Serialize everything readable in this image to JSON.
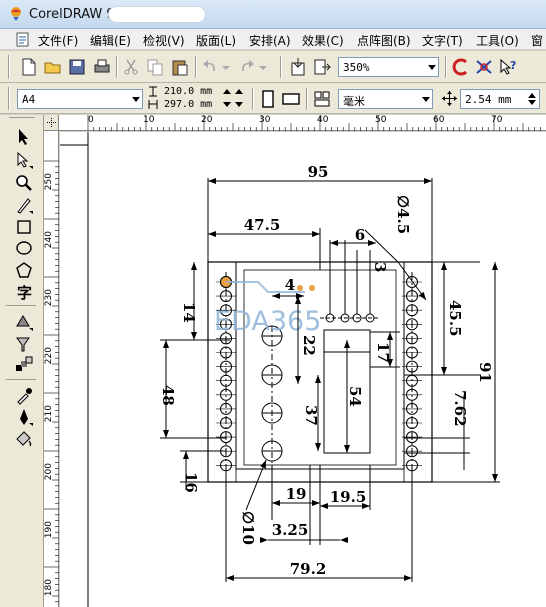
{
  "window": {
    "title": "CorelDRAW 9"
  },
  "menu": {
    "items": [
      "文件(F)",
      "编辑(E)",
      "检视(V)",
      "版面(L)",
      "安排(A)",
      "效果(C)",
      "点阵图(B)",
      "文字(T)",
      "工具(O)",
      "窗"
    ]
  },
  "toolbar": {
    "zoom_value": "350%",
    "paper_size": "A4",
    "page_width": "210.0 mm",
    "page_height": "297.0 mm",
    "units": "毫米",
    "nudge": "2.54 mm"
  },
  "ruler": {
    "top_labels": [
      "0",
      "10",
      "20",
      "30",
      "40",
      "50",
      "60",
      "70"
    ],
    "left_labels": [
      "250",
      "240",
      "230",
      "220",
      "210",
      "200",
      "190",
      "180"
    ]
  },
  "drawing": {
    "dims": {
      "d95": "95",
      "d47_5": "47.5",
      "d6": "6",
      "d3": "3",
      "dphi4_5": "∅4.5",
      "d4": "4",
      "d14": "14",
      "d45_5": "45.5",
      "d91": "91",
      "d22": "22",
      "d17": "17",
      "d48": "48",
      "d54": "54",
      "d37": "37",
      "d7_62": "7.62",
      "d16": "16",
      "d19": "19",
      "d19_5": "19.5",
      "dphi10": "∅10",
      "d3_25": "3.25",
      "d79_2": "79.2"
    },
    "watermark": "EDA365"
  },
  "colors": {
    "watermark": "#8fb4d8",
    "accent_red": "#cc2222",
    "accent_blue": "#2244aa"
  }
}
